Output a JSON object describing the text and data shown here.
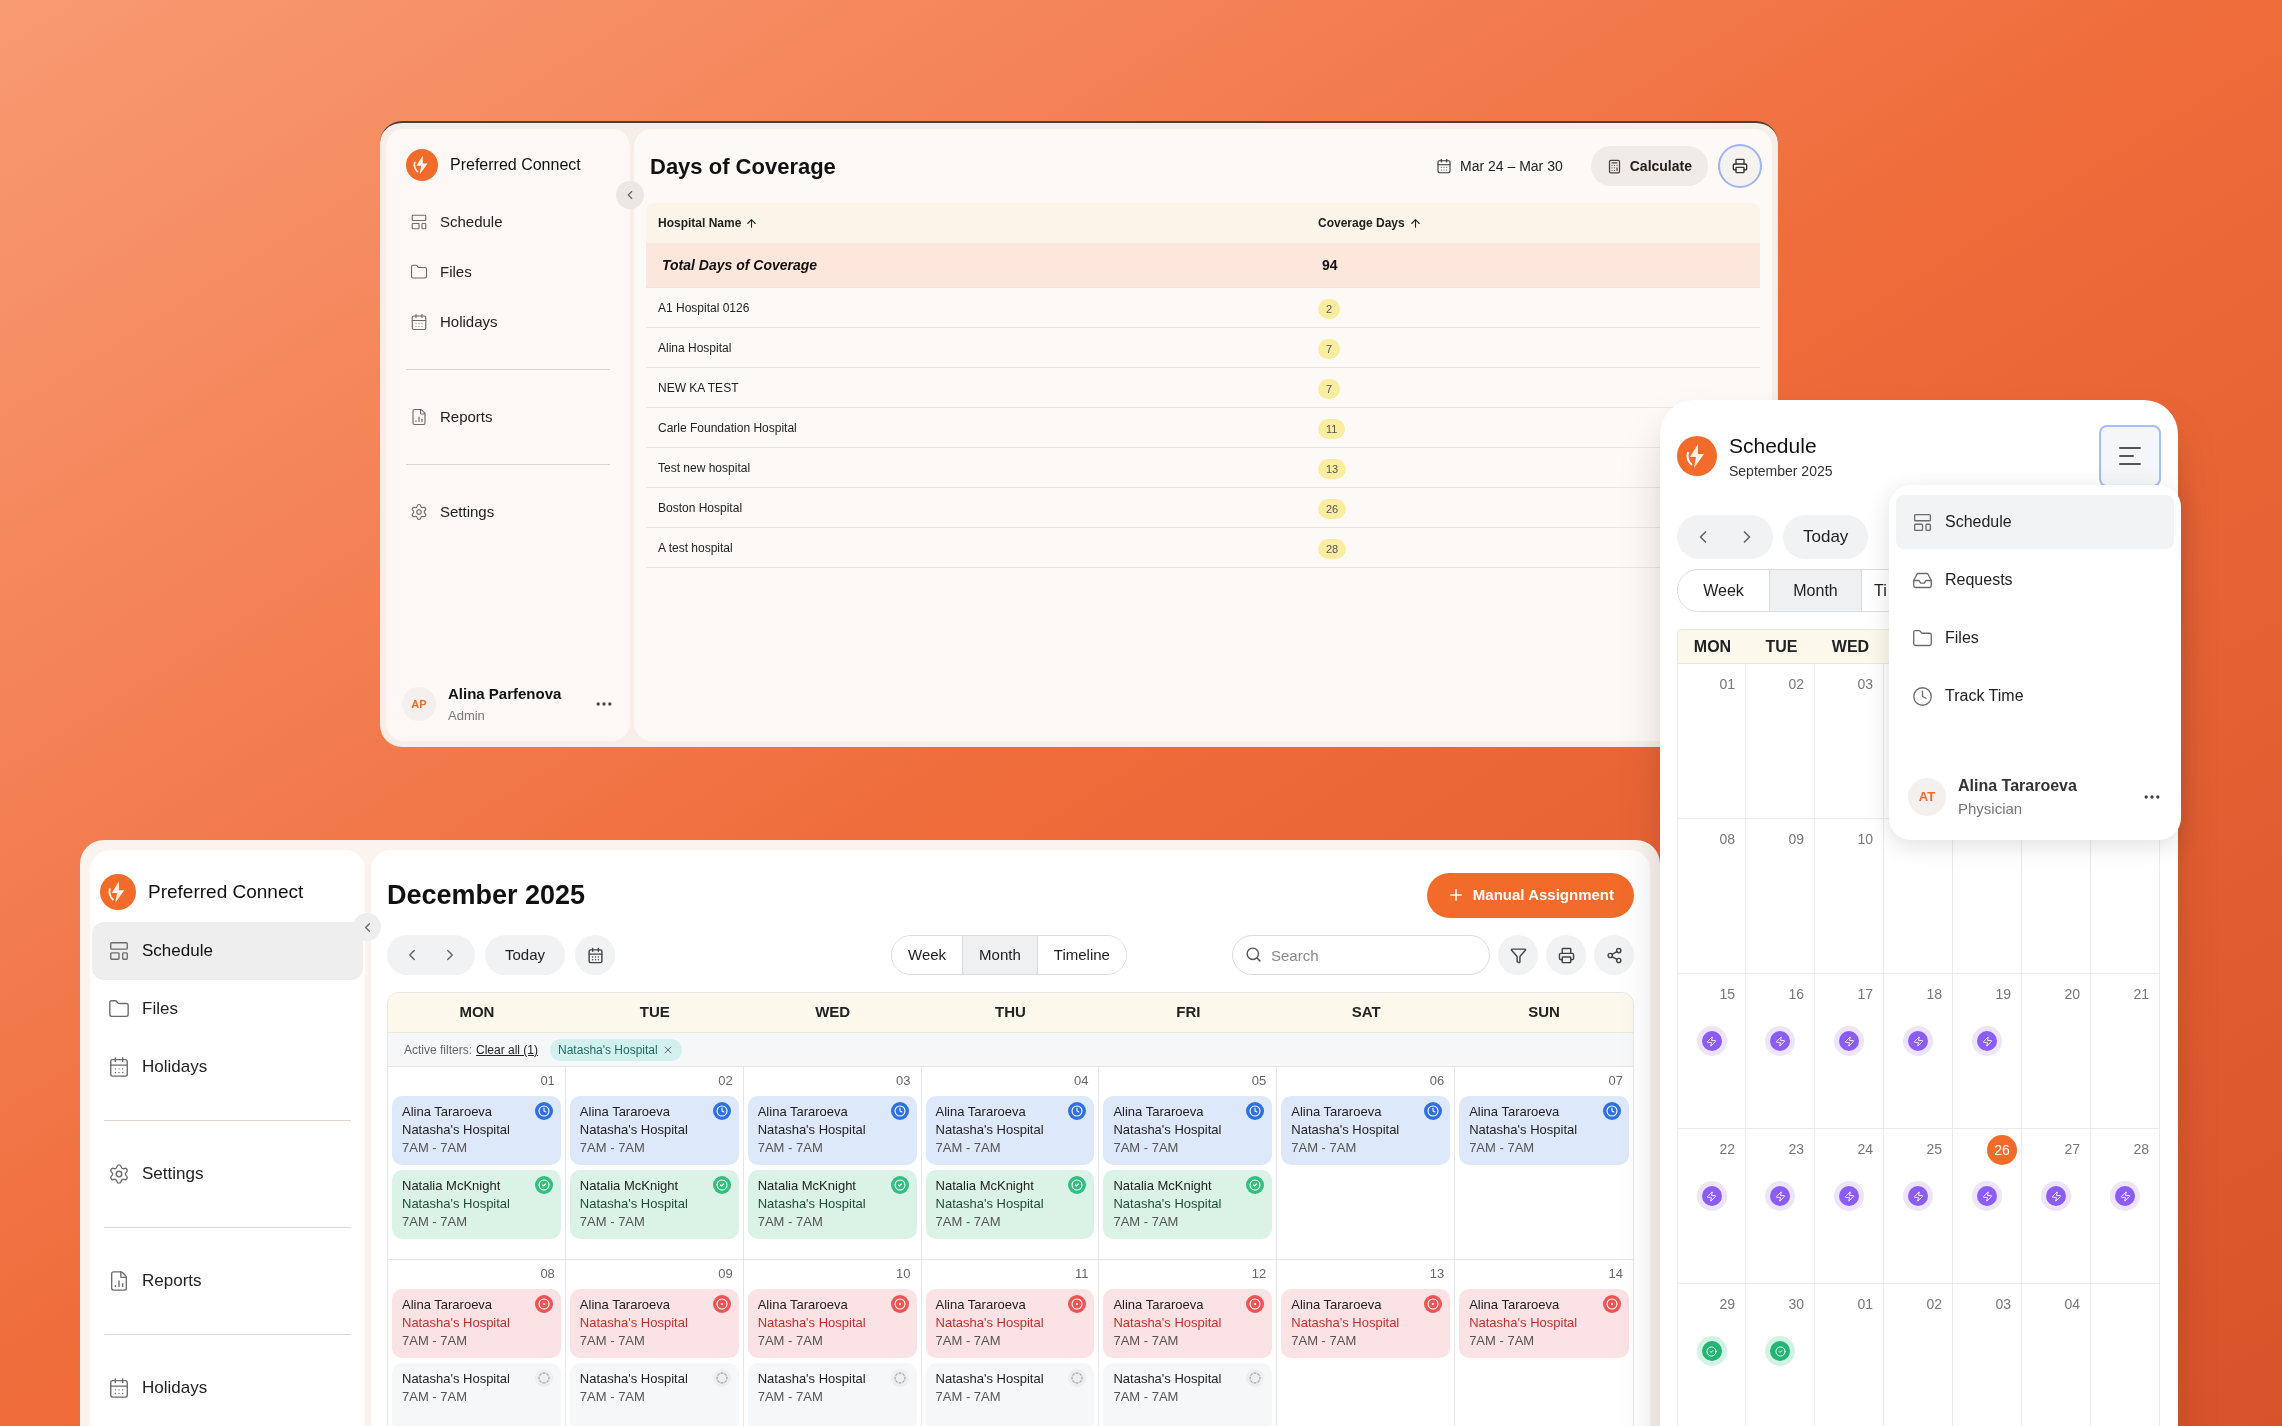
{
  "coverage_window": {
    "sidebar": {
      "brand": "Preferred Connect",
      "sections": [
        {
          "items": [
            {
              "label": "Schedule",
              "kind": "schedule",
              "selected": false
            },
            {
              "label": "Files",
              "kind": "files",
              "selected": false
            },
            {
              "label": "Holidays",
              "kind": "holidays",
              "selected": false
            }
          ]
        },
        {
          "items": [
            {
              "label": "Reports",
              "kind": "reports",
              "selected": false
            }
          ]
        },
        {
          "items": [
            {
              "label": "Settings",
              "kind": "settings",
              "selected": false
            }
          ]
        }
      ],
      "user": {
        "initials": "AP",
        "name": "Alina Parfenova",
        "role": "Admin"
      }
    },
    "title": "Days of Coverage",
    "date_range": "Mar 24 – Mar 30",
    "calculate_button": "Calculate",
    "print_button": {
      "focused": true
    },
    "table": {
      "columns": [
        {
          "label": "Hospital Name",
          "sorted": true
        },
        {
          "label": "Coverage Days",
          "sorted": true
        }
      ],
      "total": {
        "label": "Total Days of Coverage",
        "value": "94"
      },
      "rows": [
        {
          "hospital": "A1 Hospital 0126",
          "days": "2"
        },
        {
          "hospital": "Alina Hospital",
          "days": "7"
        },
        {
          "hospital": "NEW KA TEST",
          "days": "7"
        },
        {
          "hospital": "Carle Foundation Hospital",
          "days": "11"
        },
        {
          "hospital": "Test new hospital",
          "days": "13"
        },
        {
          "hospital": "Boston Hospital",
          "days": "26"
        },
        {
          "hospital": "A test hospital",
          "days": "28"
        }
      ]
    }
  },
  "schedule_mobile": {
    "title": "Schedule",
    "subtitle": "September 2025",
    "menu_button": {
      "focused": true
    },
    "today_button": "Today",
    "view_tabs": [
      {
        "label": "Week",
        "selected": false
      },
      {
        "label": "Month",
        "selected": true
      },
      {
        "label": "Ti",
        "selected": false
      }
    ],
    "weekdays": [
      "MON",
      "TUE",
      "WED"
    ],
    "weeks": [
      [
        {
          "day": "01"
        },
        {
          "day": "02"
        },
        {
          "day": "03"
        }
      ],
      [
        {
          "day": "08"
        },
        {
          "day": "09"
        },
        {
          "day": "10"
        }
      ],
      [
        {
          "day": "15",
          "kind": "pending"
        },
        {
          "day": "16",
          "kind": "pending"
        },
        {
          "day": "17",
          "kind": "pending"
        },
        {
          "day": "18",
          "kind": "pending"
        },
        {
          "day": "19",
          "kind": "pending"
        },
        {
          "day": "20"
        },
        {
          "day": "21"
        }
      ],
      [
        {
          "day": "22",
          "kind": "pending"
        },
        {
          "day": "23",
          "kind": "pending"
        },
        {
          "day": "24",
          "kind": "pending"
        },
        {
          "day": "25",
          "kind": "pending"
        },
        {
          "day": "26",
          "kind": "pending",
          "today": true
        },
        {
          "day": "27",
          "kind": "pending"
        },
        {
          "day": "28",
          "kind": "pending"
        }
      ],
      [
        {
          "day": "29",
          "kind": "approved"
        },
        {
          "day": "30",
          "kind": "approved"
        },
        {
          "day": "01"
        },
        {
          "day": "02"
        },
        {
          "day": "03"
        },
        {
          "day": "04"
        }
      ]
    ],
    "menu": {
      "items": [
        {
          "label": "Schedule",
          "kind": "schedule",
          "selected": true
        },
        {
          "label": "Requests",
          "kind": "requests",
          "selected": false
        },
        {
          "label": "Files",
          "kind": "files",
          "selected": false
        },
        {
          "label": "Track Time",
          "kind": "track_time",
          "selected": false
        }
      ],
      "user": {
        "initials": "AT",
        "name": "Alina Tararoeva",
        "role": "Physician"
      }
    }
  },
  "calendar_window": {
    "sidebar": {
      "brand": "Preferred Connect",
      "sections": [
        {
          "items": [
            {
              "label": "Schedule",
              "kind": "schedule",
              "selected": true
            },
            {
              "label": "Files",
              "kind": "files",
              "selected": false
            },
            {
              "label": "Holidays",
              "kind": "holidays",
              "selected": false
            }
          ]
        },
        {
          "items": [
            {
              "label": "Settings",
              "kind": "settings",
              "selected": false
            }
          ]
        },
        {
          "items": [
            {
              "label": "Reports",
              "kind": "reports",
              "selected": false
            }
          ]
        },
        {
          "items": [
            {
              "label": "Holidays",
              "kind": "holidays",
              "selected": false
            }
          ]
        }
      ]
    },
    "title": "December 2025",
    "action_button": "Manual Assignment",
    "today_button": "Today",
    "view_tabs": [
      {
        "label": "Week",
        "selected": false
      },
      {
        "label": "Month",
        "selected": true
      },
      {
        "label": "Timeline",
        "selected": false
      }
    ],
    "search": {
      "placeholder": "Search"
    },
    "weekdays": [
      "MON",
      "TUE",
      "WED",
      "THU",
      "FRI",
      "SAT",
      "SUN"
    ],
    "filters": {
      "label": "Active filters:",
      "clear": "Clear all (1)",
      "chips": [
        "Natasha's Hospital"
      ]
    },
    "weeks": [
      [
        {
          "day": "01",
          "events": [
            {
              "kind": "scheduled",
              "person": "Alina Tararoeva",
              "hospital": "Natasha's Hospital",
              "time": "7AM - 7AM"
            },
            {
              "kind": "approved",
              "person": "Natalia McKnight",
              "hospital": "Natasha's Hospital",
              "time": "7AM - 7AM"
            }
          ]
        },
        {
          "day": "02",
          "events": [
            {
              "kind": "scheduled",
              "person": "Alina Tararoeva",
              "hospital": "Natasha's Hospital",
              "time": "7AM - 7AM"
            },
            {
              "kind": "approved",
              "person": "Natalia McKnight",
              "hospital": "Natasha's Hospital",
              "time": "7AM - 7AM"
            }
          ]
        },
        {
          "day": "03",
          "events": [
            {
              "kind": "scheduled",
              "person": "Alina Tararoeva",
              "hospital": "Natasha's Hospital",
              "time": "7AM - 7AM"
            },
            {
              "kind": "approved",
              "person": "Natalia McKnight",
              "hospital": "Natasha's Hospital",
              "time": "7AM - 7AM"
            }
          ]
        },
        {
          "day": "04",
          "events": [
            {
              "kind": "scheduled",
              "person": "Alina Tararoeva",
              "hospital": "Natasha's Hospital",
              "time": "7AM - 7AM"
            },
            {
              "kind": "approved",
              "person": "Natalia McKnight",
              "hospital": "Natasha's Hospital",
              "time": "7AM - 7AM"
            }
          ]
        },
        {
          "day": "05",
          "events": [
            {
              "kind": "scheduled",
              "person": "Alina Tararoeva",
              "hospital": "Natasha's Hospital",
              "time": "7AM - 7AM"
            },
            {
              "kind": "approved",
              "person": "Natalia McKnight",
              "hospital": "Natasha's Hospital",
              "time": "7AM - 7AM"
            }
          ]
        },
        {
          "day": "06",
          "events": [
            {
              "kind": "scheduled",
              "person": "Alina Tararoeva",
              "hospital": "Natasha's Hospital",
              "time": "7AM - 7AM"
            }
          ]
        },
        {
          "day": "07",
          "events": [
            {
              "kind": "scheduled",
              "person": "Alina Tararoeva",
              "hospital": "Natasha's Hospital",
              "time": "7AM - 7AM"
            }
          ]
        }
      ],
      [
        {
          "day": "08",
          "events": [
            {
              "kind": "declined",
              "person": "Alina Tararoeva",
              "hospital": "Natasha's Hospital",
              "time": "7AM - 7AM"
            },
            {
              "kind": "open",
              "hospital": "Natasha's Hospital",
              "time": "7AM - 7AM"
            }
          ]
        },
        {
          "day": "09",
          "events": [
            {
              "kind": "declined",
              "person": "Alina Tararoeva",
              "hospital": "Natasha's Hospital",
              "time": "7AM - 7AM"
            },
            {
              "kind": "open",
              "hospital": "Natasha's Hospital",
              "time": "7AM - 7AM"
            }
          ]
        },
        {
          "day": "10",
          "events": [
            {
              "kind": "declined",
              "person": "Alina Tararoeva",
              "hospital": "Natasha's Hospital",
              "time": "7AM - 7AM"
            },
            {
              "kind": "open",
              "hospital": "Natasha's Hospital",
              "time": "7AM - 7AM"
            }
          ]
        },
        {
          "day": "11",
          "events": [
            {
              "kind": "declined",
              "person": "Alina Tararoeva",
              "hospital": "Natasha's Hospital",
              "time": "7AM - 7AM"
            },
            {
              "kind": "open",
              "hospital": "Natasha's Hospital",
              "time": "7AM - 7AM"
            }
          ]
        },
        {
          "day": "12",
          "events": [
            {
              "kind": "declined",
              "person": "Alina Tararoeva",
              "hospital": "Natasha's Hospital",
              "time": "7AM - 7AM"
            },
            {
              "kind": "open",
              "hospital": "Natasha's Hospital",
              "time": "7AM - 7AM"
            }
          ]
        },
        {
          "day": "13",
          "events": [
            {
              "kind": "declined",
              "person": "Alina Tararoeva",
              "hospital": "Natasha's Hospital",
              "time": "7AM - 7AM"
            }
          ]
        },
        {
          "day": "14",
          "events": [
            {
              "kind": "declined",
              "person": "Alina Tararoeva",
              "hospital": "Natasha's Hospital",
              "time": "7AM - 7AM"
            }
          ]
        }
      ]
    ]
  }
}
